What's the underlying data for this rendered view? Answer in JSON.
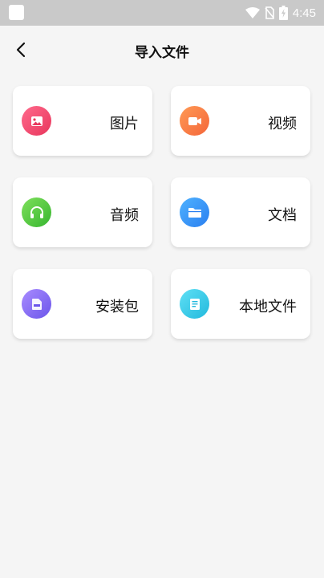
{
  "status_bar": {
    "time": "4:45"
  },
  "header": {
    "title": "导入文件"
  },
  "categories": [
    {
      "label": "图片",
      "icon": "image-icon",
      "color": "#e8365c"
    },
    {
      "label": "视频",
      "icon": "video-icon",
      "color": "#f4663a"
    },
    {
      "label": "音频",
      "icon": "headphones-icon",
      "color": "#36b52f"
    },
    {
      "label": "文档",
      "icon": "folder-icon",
      "color": "#2a7ff0"
    },
    {
      "label": "安装包",
      "icon": "apk-icon",
      "color": "#6b55ea"
    },
    {
      "label": "本地文件",
      "icon": "file-icon",
      "color": "#22b9dd"
    }
  ]
}
